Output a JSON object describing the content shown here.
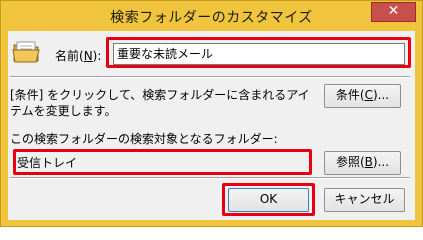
{
  "window": {
    "title": "検索フォルダーのカスタマイズ",
    "close_glyph": "✕",
    "frame_color": "#f0c43c",
    "close_color": "#c7504a"
  },
  "name_field": {
    "label_prefix": "名前(",
    "label_accel": "N",
    "label_suffix": "):",
    "value": "重要な未読メール"
  },
  "conditions": {
    "description": "[条件] をクリックして、検索フォルダーに含まれるアイテムを変更します。",
    "button_prefix": "条件(",
    "button_accel": "C",
    "button_suffix": ")..."
  },
  "target": {
    "label": "この検索フォルダーの検索対象となるフォルダー:",
    "value": "受信トレイ",
    "browse_prefix": "参照(",
    "browse_accel": "B",
    "browse_suffix": ")..."
  },
  "footer": {
    "ok_label": "OK",
    "cancel_label": "キャンセル"
  },
  "highlight_color": "#e60012"
}
